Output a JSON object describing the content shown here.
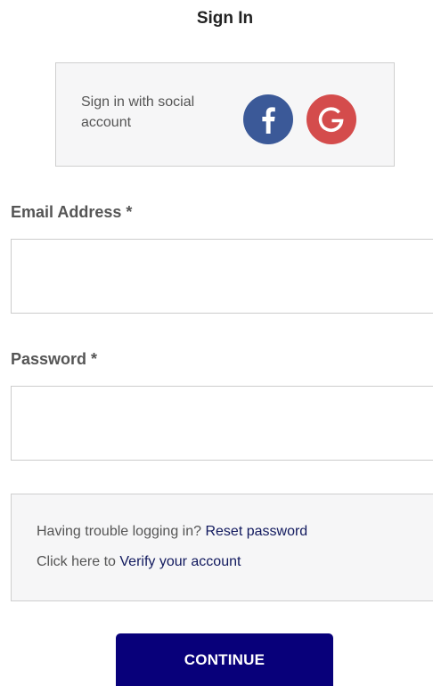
{
  "header": {
    "title": "Sign In"
  },
  "social": {
    "prompt": "Sign in with social account",
    "buttons": [
      {
        "name": "facebook",
        "icon": "facebook-icon",
        "glyph": "f",
        "color": "#3b5998"
      },
      {
        "name": "google",
        "icon": "google-icon",
        "glyph": "G",
        "color": "#d44c4c"
      }
    ]
  },
  "form": {
    "email": {
      "label": "Email Address *",
      "value": "",
      "placeholder": ""
    },
    "password": {
      "label": "Password *",
      "value": "",
      "placeholder": ""
    }
  },
  "help": {
    "trouble_text": "Having trouble logging in?",
    "reset_link": "Reset password",
    "verify_text": "Click here to",
    "verify_link": "Verify your account"
  },
  "actions": {
    "continue_label": "CONTINUE"
  },
  "colors": {
    "primary_button": "#08007a",
    "link": "#11195e",
    "panel_background": "#f6f6f7"
  }
}
